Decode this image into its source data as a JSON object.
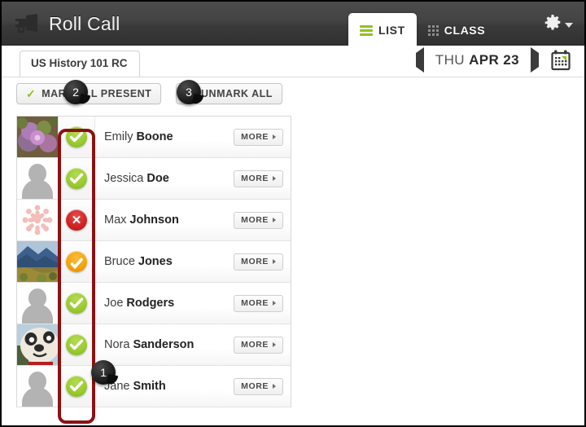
{
  "header": {
    "title": "Roll Call",
    "logo_icon": "megaphone-icon",
    "tabs": [
      {
        "label": "LIST",
        "icon": "list-lines-icon",
        "active": true
      },
      {
        "label": "CLASS",
        "icon": "grid-dots-icon",
        "active": false
      }
    ],
    "settings_icon": "gear-icon",
    "settings_caret_icon": "chevron-down-icon"
  },
  "subbar": {
    "course_tab": "US History 101 RC",
    "prev_icon": "triangle-left-icon",
    "next_icon": "triangle-right-icon",
    "date_dow": "THU",
    "date_monthday": "APR 23",
    "calendar_icon": "calendar-icon"
  },
  "actions": {
    "mark_all_present": "MARK ALL PRESENT",
    "mark_all_present_icon": "check-icon",
    "unmark_all": "UNMARK ALL",
    "unmark_all_icon": "undo-arrow-icon"
  },
  "list": {
    "more_label": "MORE",
    "students": [
      {
        "first": "Emily",
        "last": "Boone",
        "status": "present",
        "status_icon": "check-circle-icon",
        "avatar": "photo-purple-flowers"
      },
      {
        "first": "Jessica",
        "last": "Doe",
        "status": "present",
        "status_icon": "check-circle-icon",
        "avatar": "default-silhouette"
      },
      {
        "first": "Max",
        "last": "Johnson",
        "status": "absent",
        "status_icon": "x-circle-icon",
        "avatar": "canvas-logo"
      },
      {
        "first": "Bruce",
        "last": "Jones",
        "status": "late",
        "status_icon": "half-check-circle-icon",
        "avatar": "photo-mountain"
      },
      {
        "first": "Joe",
        "last": "Rodgers",
        "status": "present",
        "status_icon": "check-circle-icon",
        "avatar": "default-silhouette"
      },
      {
        "first": "Nora",
        "last": "Sanderson",
        "status": "present",
        "status_icon": "check-circle-icon",
        "avatar": "photo-panda-mascot"
      },
      {
        "first": "Jane",
        "last": "Smith",
        "status": "present",
        "status_icon": "check-circle-icon",
        "avatar": "default-silhouette"
      }
    ]
  },
  "callouts": [
    {
      "number": "1"
    },
    {
      "number": "2"
    },
    {
      "number": "3"
    }
  ],
  "colors": {
    "present_green": "#9ccb32",
    "absent_red": "#d02525",
    "late_orange": "#f5a50d",
    "accent_green": "#8fc220",
    "highlight_red": "#8c1111",
    "header_dark": "#434343"
  }
}
